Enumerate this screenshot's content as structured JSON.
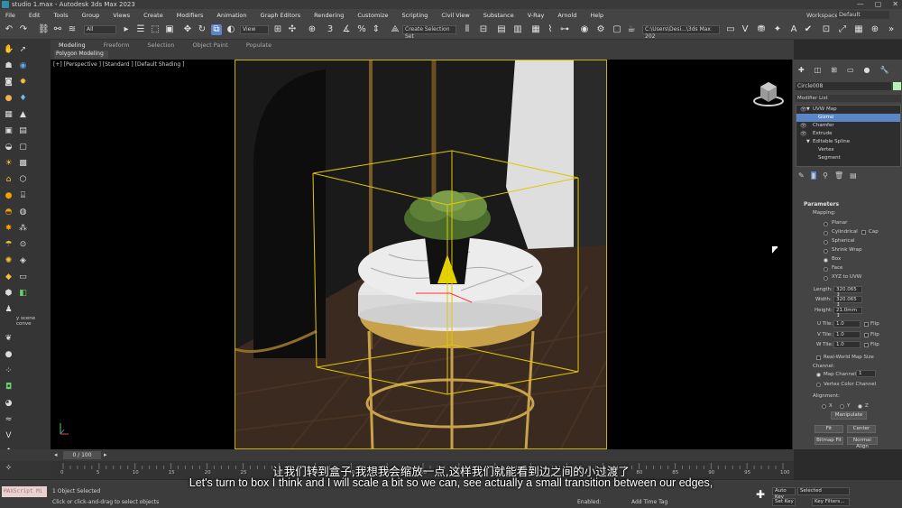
{
  "window": {
    "title": "studio 1.max - Autodesk 3ds Max 2023",
    "minimize": "—",
    "maximize": "▢",
    "close": "✕"
  },
  "menu": {
    "items": [
      "File",
      "Edit",
      "Tools",
      "Group",
      "Views",
      "Create",
      "Modifiers",
      "Animation",
      "Graph Editors",
      "Rendering",
      "Customize",
      "Scripting",
      "Civil View",
      "Substance",
      "V-Ray",
      "Arnold",
      "Help"
    ],
    "workspaces_label": "Workspaces:",
    "workspaces_value": "Default"
  },
  "toolbar": {
    "selection_filter": "All",
    "ref_coord": "View",
    "named_selection": "Create Selection Set",
    "project_path": "C:\\Users\\Desi...\\3ds Max 202"
  },
  "ribbon": {
    "tabs": [
      "Modeling",
      "Freeform",
      "Selection",
      "Object Paint",
      "Populate"
    ],
    "active_tab": "Modeling",
    "sub_label": "Polygon Modeling"
  },
  "left_toolbar": {
    "scene_label": "y scene conve"
  },
  "viewport": {
    "label": "[+] [Perspective ] [Standard ] [Default Shading ]"
  },
  "command_panel": {
    "object_name": "Circle008",
    "object_color": "#b7f0b7",
    "modifier_list": "Modifier List",
    "stack": [
      {
        "label": "UVW Map",
        "indent": 1,
        "expand": "▼",
        "eye": true,
        "selected": false
      },
      {
        "label": "Gizmo",
        "indent": 2,
        "expand": "",
        "eye": false,
        "selected": true
      },
      {
        "label": "Chamfer",
        "indent": 1,
        "expand": "",
        "eye": true,
        "selected": false
      },
      {
        "label": "Extrude",
        "indent": 1,
        "expand": "",
        "eye": true,
        "selected": false
      },
      {
        "label": "Editable Spline",
        "indent": 1,
        "expand": "▼",
        "eye": false,
        "selected": false
      },
      {
        "label": "Vertex",
        "indent": 2,
        "expand": "",
        "eye": false,
        "selected": false
      },
      {
        "label": "Segment",
        "indent": 2,
        "expand": "",
        "eye": false,
        "selected": false
      }
    ],
    "parameters": {
      "header": "Parameters",
      "mapping_label": "Mapping:",
      "mapping_options": [
        "Planar",
        "Cylindrical",
        "Spherical",
        "Shrink Wrap",
        "Box",
        "Face",
        "XYZ to UVW"
      ],
      "mapping_selected": "Box",
      "cap_label": "Cap",
      "length_label": "Length:",
      "length_value": "320.065 ↕",
      "width_label": "Width:",
      "width_value": "320.065 ↕",
      "height_label": "Height:",
      "height_value": "21.0mm ↕",
      "utile_label": "U Tile:",
      "utile_value": "1.0",
      "vtile_label": "V Tile:",
      "vtile_value": "1.0",
      "wtile_label": "W Tile:",
      "wtile_value": "1.0",
      "flip_label": "Flip",
      "real_world": "Real-World Map Size",
      "channel_label": "Channel:",
      "map_channel": "Map Channel:",
      "map_channel_value": "1",
      "vertex_color": "Vertex Color Channel",
      "alignment_label": "Alignment:",
      "align_x": "X",
      "align_y": "Y",
      "align_z": "Z",
      "manipulate": "Manipulate",
      "fit": "Fit",
      "center": "Center",
      "bitmap_fit": "Bitmap Fit",
      "normal_align": "Normal Align"
    }
  },
  "timeline": {
    "frames": "0 / 100",
    "ticks": [
      "0",
      "5",
      "10",
      "15",
      "20",
      "25",
      "30",
      "35",
      "40",
      "45",
      "50",
      "55",
      "60",
      "65",
      "70",
      "75",
      "80",
      "85",
      "90",
      "95",
      "100"
    ]
  },
  "status": {
    "maxscript": "MAXScript Mi",
    "selected_text": "1 Object Selected",
    "prompt_text": "Click or click-and-drag to select objects",
    "enabled_label": "Enabled:",
    "add_time_tag": "Add Time Tag",
    "auto_key": "Auto Key",
    "selected_dd": "Selected",
    "set_key": "Set Key",
    "key_filters": "Key Filters..."
  },
  "subtitles": {
    "chinese": "让我们转到盒子,我想我会缩放一点,这样我们就能看到边之间的小过渡了",
    "english": "Let's turn to box I think and I will scale a bit so we can, see actually a small transition between our edges,"
  }
}
